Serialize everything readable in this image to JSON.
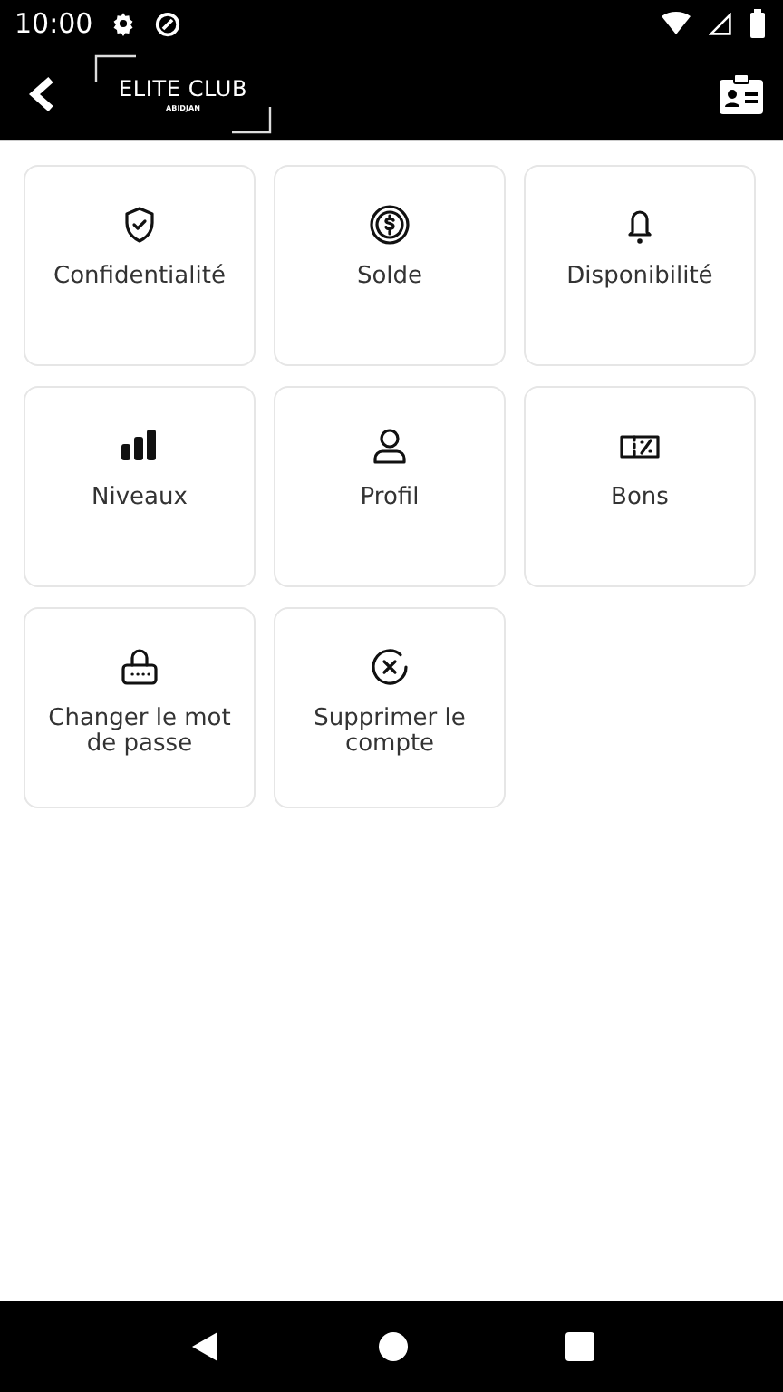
{
  "status_bar": {
    "time": "10:00"
  },
  "app_bar": {
    "logo_title": "ELITE CLUB",
    "logo_subtitle": "ABIDJAN"
  },
  "tiles": [
    {
      "kind": "shield",
      "label": "Confidentialité"
    },
    {
      "kind": "coin",
      "label": "Solde"
    },
    {
      "kind": "bell",
      "label": "Disponibilité"
    },
    {
      "kind": "levels",
      "label": "Niveaux"
    },
    {
      "kind": "user",
      "label": "Profil"
    },
    {
      "kind": "voucher",
      "label": "Bons"
    },
    {
      "kind": "lock",
      "label": "Changer le mot de passe"
    },
    {
      "kind": "delete",
      "label": "Supprimer le compte"
    }
  ]
}
